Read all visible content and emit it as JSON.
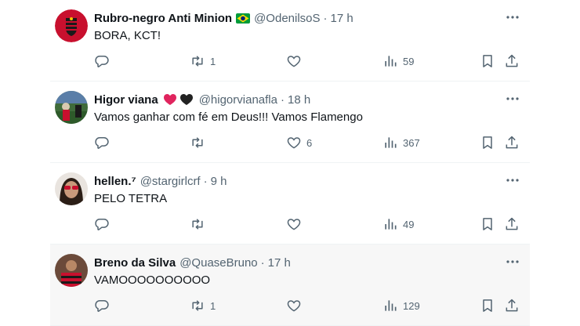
{
  "tweets": [
    {
      "name": "Rubro-negro Anti Minion",
      "badge": "brazil-flag-emoji",
      "handle": "@OdenilsoS",
      "time": "17 h",
      "text": "BORA, KCT!",
      "replies": "",
      "retweets": "1",
      "likes": "",
      "views": "59"
    },
    {
      "name": "Higor viana",
      "badge": "red-and-black-hearts-emoji",
      "handle": "@higorvianafla",
      "time": "18 h",
      "text": "Vamos ganhar com fé em Deus!!! Vamos Flamengo",
      "replies": "",
      "retweets": "",
      "likes": "6",
      "views": "367"
    },
    {
      "name": "hellen.⁷",
      "badge": "",
      "handle": "@stargirlcrf",
      "time": "9 h",
      "text": "PELO TETRA",
      "replies": "",
      "retweets": "",
      "likes": "",
      "views": "49"
    },
    {
      "name": "Breno da Silva",
      "badge": "",
      "handle": "@QuaseBruno",
      "time": "17 h",
      "text": "VAMOOOOOOOOOO",
      "replies": "",
      "retweets": "1",
      "likes": "",
      "views": "129"
    }
  ],
  "separator": "·",
  "colors": {
    "text": "#0f1419",
    "secondary": "#536471",
    "border": "#eff3f4",
    "hover_bg": "#f7f7f7",
    "heart_red": "#e0245e"
  },
  "icons": [
    "reply-icon",
    "retweet-icon",
    "like-icon",
    "views-icon",
    "bookmark-icon",
    "share-icon",
    "more-icon"
  ]
}
